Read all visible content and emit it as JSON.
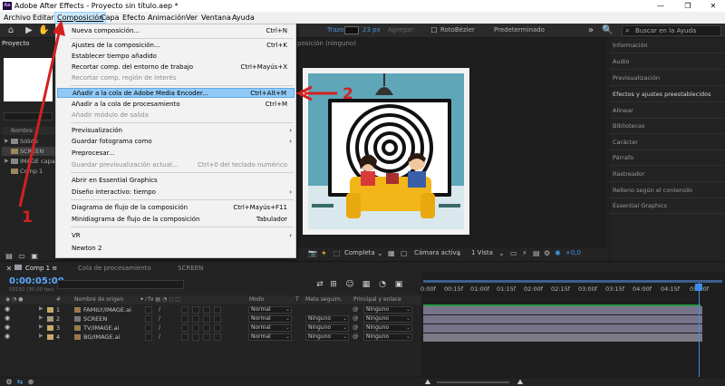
{
  "window": {
    "title": "Adobe After Effects - Proyecto sin título.aep *",
    "logo_text": "Ae",
    "minimize": "—",
    "maximize": "❐",
    "close": "✕"
  },
  "menubar": {
    "items": [
      "Archivo",
      "Editar",
      "Composición",
      "Capa",
      "Efecto",
      "Animación",
      "Ver",
      "Ventana",
      "Ayuda"
    ]
  },
  "toolbar": {
    "stroke_label": "Trazo",
    "stroke_px": "23 px",
    "add_label": "Agregar:",
    "rotobezier": "RotoBézier",
    "workspace": "Predeterminado",
    "search_placeholder": "Buscar en la Ayuda"
  },
  "project": {
    "tab": "Proyecto",
    "column_name": "Nombre",
    "items": [
      {
        "name": "Sólido"
      },
      {
        "name": "SCREEN"
      },
      {
        "name": "IMAGE capa"
      },
      {
        "name": "Comp 1"
      }
    ]
  },
  "viewer": {
    "tab": "posición (ninguno)",
    "quality": "Completa",
    "camera": "Cámara activa",
    "views": "1 Vista",
    "exposure": "+0,0"
  },
  "composition_menu": {
    "items": [
      {
        "label": "Nueva composición...",
        "shortcut": "Ctrl+N",
        "disabled": false
      },
      {
        "label": "Ajustes de la composición...",
        "shortcut": "Ctrl+K",
        "disabled": false
      },
      {
        "label": "Establecer tiempo añadido",
        "shortcut": "",
        "disabled": false
      },
      {
        "label": "Recortar comp. del entorno de trabajo",
        "shortcut": "Ctrl+Mayús+X",
        "disabled": false
      },
      {
        "label": "Recortar comp. región de interés",
        "shortcut": "",
        "disabled": true
      },
      {
        "label": "Añadir a la cola de Adobe Media Encoder...",
        "shortcut": "Ctrl+Alt+M",
        "disabled": false,
        "highlight": true
      },
      {
        "label": "Añadir a la cola de procesamiento",
        "shortcut": "Ctrl+M",
        "disabled": false
      },
      {
        "label": "Añadir módulo de salida",
        "shortcut": "",
        "disabled": true
      },
      {
        "label": "Previsualización",
        "shortcut": "",
        "submenu": true
      },
      {
        "label": "Guardar fotograma como",
        "shortcut": "",
        "submenu": true
      },
      {
        "label": "Preprocesar...",
        "shortcut": ""
      },
      {
        "label": "Guardar previsualización actual...",
        "shortcut": "Ctrl+0 del teclado numérico",
        "disabled": true
      },
      {
        "label": "Abrir en Essential Graphics",
        "shortcut": ""
      },
      {
        "label": "Diseño interactivo: tiempo",
        "shortcut": "",
        "submenu": true
      },
      {
        "label": "Diagrama de flujo de la composición",
        "shortcut": "Ctrl+Mayús+F11"
      },
      {
        "label": "Minidiagrama de flujo de la composición",
        "shortcut": "Tabulador"
      },
      {
        "label": "VR",
        "shortcut": "",
        "submenu": true
      },
      {
        "label": "Newton 2",
        "shortcut": ""
      }
    ]
  },
  "right_panel": {
    "items": [
      "Información",
      "Audio",
      "Previsualización",
      "Efectos y ajustes preestablecidos",
      "Alinear",
      "Bibliotecas",
      "Carácter",
      "Párrafo",
      "Rastreador",
      "Relleno según el contenido",
      "Essential Graphics"
    ]
  },
  "timeline": {
    "tabs": [
      "Comp 1",
      "Cola de procesamiento",
      "SCREEN"
    ],
    "timecode": "0:00:05:00",
    "fps": "00150 (30.00 fps)",
    "headers": {
      "source": "Nombre de origen",
      "mode": "Modo",
      "t": "T",
      "matte": "Mate seguim.",
      "parent": "Principal y enlace"
    },
    "layers": [
      {
        "num": "1",
        "name": "FAMILY/IMAGE.ai",
        "mode": "Normal",
        "matte": "",
        "parent": "Ninguno",
        "color": "#c8a96a"
      },
      {
        "num": "2",
        "name": "SCREEN",
        "mode": "Normal",
        "matte": "Ninguno",
        "parent": "Ninguno",
        "color": "#a89a78"
      },
      {
        "num": "3",
        "name": "TV/IMAGE.ai",
        "mode": "Normal",
        "matte": "Ninguno",
        "parent": "Ninguno",
        "color": "#c8a96a"
      },
      {
        "num": "4",
        "name": "BG/IMAGE.ai",
        "mode": "Normal",
        "matte": "Ninguno",
        "parent": "Ninguno",
        "color": "#c8a96a"
      }
    ],
    "ruler": [
      "0:00f",
      "00:15f",
      "01:00f",
      "01:15f",
      "02:00f",
      "02:15f",
      "03:00f",
      "03:15f",
      "04:00f",
      "04:15f",
      "05:00f"
    ]
  },
  "annotations": {
    "label1": "1",
    "label2": "2",
    "color": "#d42020"
  }
}
